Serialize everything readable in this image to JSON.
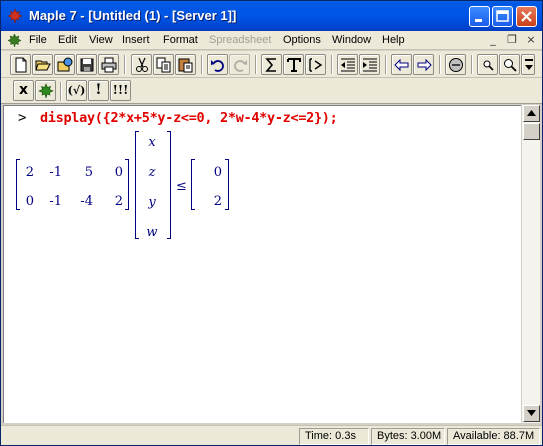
{
  "window": {
    "title": "Maple 7  - [Untitled (1) - [Server 1]]",
    "app_icon": "maple-leaf-icon",
    "controls": [
      "minimize-icon",
      "maximize-icon",
      "close-icon"
    ]
  },
  "menubar": {
    "items": [
      {
        "label": "File"
      },
      {
        "label": "Edit"
      },
      {
        "label": "View"
      },
      {
        "label": "Insert"
      },
      {
        "label": "Format"
      },
      {
        "label": "Spreadsheet",
        "disabled": true
      },
      {
        "label": "Options"
      },
      {
        "label": "Window"
      },
      {
        "label": "Help"
      }
    ],
    "mdi_minimize": "_",
    "mdi_restore": "❐",
    "mdi_close": "×"
  },
  "toolbar2": {
    "text_toggle": "x",
    "evaluate_label": "(√)",
    "exec_label": "!",
    "exec_all_label": "!!!"
  },
  "document": {
    "prompt": ">",
    "input": "display({2*x+5*y-z<=0, 2*w-4*y-z<=2});",
    "output": {
      "matrix_a": [
        [
          "2",
          "-1",
          "5",
          "0"
        ],
        [
          "0",
          "-1",
          "-4",
          "2"
        ]
      ],
      "vector_x": [
        "x",
        "z",
        "y",
        "w"
      ],
      "relation": "≤",
      "vector_b": [
        "0",
        "2"
      ]
    }
  },
  "status": {
    "time": "Time:  0.3s",
    "bytes": "Bytes: 3.00M",
    "available": "Available: 88.7M"
  },
  "colors": {
    "titlebar": "#0055e5",
    "input_text": "#e00000",
    "output_text": "#000080",
    "chrome": "#ece9d8"
  }
}
